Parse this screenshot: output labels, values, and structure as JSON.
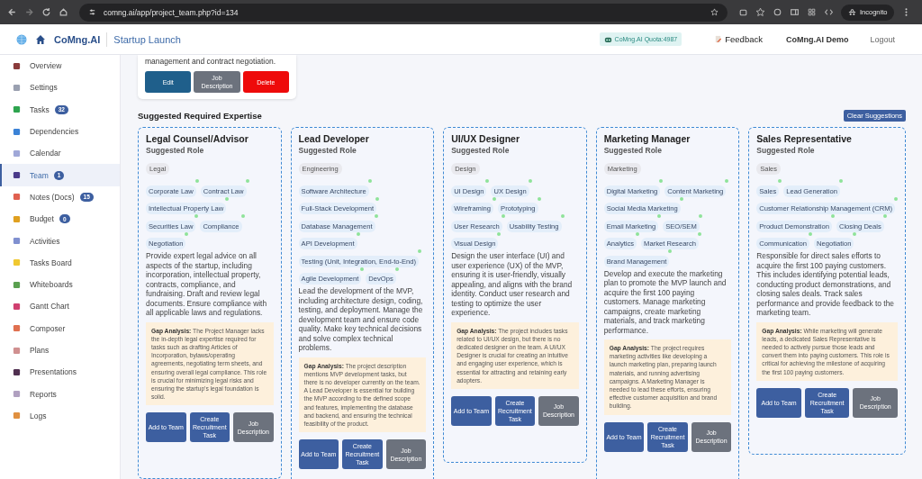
{
  "browser": {
    "url": "comng.ai/app/project_team.php?id=134",
    "profile": "Incognito"
  },
  "header": {
    "brand": "CoMng.AI",
    "project": "Startup Launch",
    "quota": "CoMng.AI Quota:4987",
    "feedback": "Feedback",
    "user": "CoMng.AI Demo",
    "logout": "Logout"
  },
  "sidebar": {
    "items": [
      {
        "label": "Overview",
        "selected": false
      },
      {
        "label": "Settings",
        "selected": false
      },
      {
        "label": "Tasks",
        "badge": "32",
        "selected": false
      },
      {
        "label": "Dependencies",
        "selected": false
      },
      {
        "label": "Calendar",
        "selected": false
      },
      {
        "label": "Team",
        "badge": "1",
        "selected": true
      },
      {
        "label": "Notes (Docs)",
        "badge": "15",
        "selected": false
      },
      {
        "label": "Budget",
        "badge": "0",
        "selected": false
      },
      {
        "label": "Activities",
        "selected": false
      },
      {
        "label": "Tasks Board",
        "selected": false
      },
      {
        "label": "Whiteboards",
        "selected": false
      },
      {
        "label": "Gantt Chart",
        "selected": false
      },
      {
        "label": "Composer",
        "selected": false
      },
      {
        "label": "Plans",
        "selected": false
      },
      {
        "label": "Presentations",
        "selected": false
      },
      {
        "label": "Reports",
        "selected": false
      },
      {
        "label": "Logs",
        "selected": false
      }
    ]
  },
  "member_card": {
    "description": "management and contract negotiation.",
    "buttons": [
      {
        "label": "Edit",
        "kind": "edit"
      },
      {
        "label": "Job Description",
        "kind": "secondary"
      },
      {
        "label": "Delete",
        "kind": "danger"
      }
    ]
  },
  "suggestions": {
    "title": "Suggested Required Expertise",
    "clear_button": "Clear Suggestions",
    "roles": [
      {
        "title": "Legal Counsel/Advisor",
        "subtitle": "Suggested Role",
        "category": "Legal",
        "skills": [
          "Corporate Law",
          "Contract Law",
          "Intellectual Property Law",
          "Securities Law",
          "Compliance",
          "Negotiation"
        ],
        "description": "Provide expert legal advice on all aspects of the startup, including incorporation, intellectual property, contracts, compliance, and fundraising. Draft and review legal documents. Ensure compliance with all applicable laws and regulations.",
        "gap": "**Gap Analysis:** The Project Manager lacks the in-depth legal expertise required for tasks such as drafting Articles of Incorporation, bylaws/operating agreements, negotiating term sheets, and ensuring overall legal compliance. This role is crucial for minimizing legal risks and ensuring the startup's legal foundation is solid.",
        "buttons": [
          {
            "label": "Add to Team",
            "kind": "primary"
          },
          {
            "label": "Create Recruitment Task",
            "kind": "primary"
          },
          {
            "label": "Job Description",
            "kind": "secondary"
          }
        ]
      },
      {
        "title": "Lead Developer",
        "subtitle": "Suggested Role",
        "category": "Engineering",
        "skills": [
          "Software Architecture",
          "Full-Stack Development",
          "Database Management",
          "API Development",
          "Testing (Unit, Integration, End-to-End)",
          "Agile Development",
          "DevOps"
        ],
        "description": "Lead the development of the MVP, including architecture design, coding, testing, and deployment. Manage the development team and ensure code quality. Make key technical decisions and solve complex technical problems.",
        "gap": "**Gap Analysis:** The project description mentions MVP development tasks, but there is no developer currently on the team. A Lead Developer is essential for building the MVP according to the defined scope and features, implementing the database and backend, and ensuring the technical feasibility of the product.",
        "buttons": [
          {
            "label": "Add to Team",
            "kind": "primary"
          },
          {
            "label": "Create Recruitment Task",
            "kind": "primary"
          },
          {
            "label": "Job Description",
            "kind": "secondary"
          }
        ]
      },
      {
        "title": "UI/UX Designer",
        "subtitle": "Suggested Role",
        "category": "Design",
        "skills": [
          "UI Design",
          "UX Design",
          "Wireframing",
          "Prototyping",
          "User Research",
          "Usability Testing",
          "Visual Design"
        ],
        "description": "Design the user interface (UI) and user experience (UX) of the MVP, ensuring it is user-friendly, visually appealing, and aligns with the brand identity. Conduct user research and testing to optimize the user experience.",
        "gap": "**Gap Analysis:** The project includes tasks related to UI/UX design, but there is no dedicated designer on the team. A UI/UX Designer is crucial for creating an intuitive and engaging user experience, which is essential for attracting and retaining early adopters.",
        "buttons": [
          {
            "label": "Add to Team",
            "kind": "primary"
          },
          {
            "label": "Create Recruitment Task",
            "kind": "primary"
          },
          {
            "label": "Job Description",
            "kind": "secondary"
          }
        ]
      },
      {
        "title": "Marketing Manager",
        "subtitle": "Suggested Role",
        "category": "Marketing",
        "skills": [
          "Digital Marketing",
          "Content Marketing",
          "Social Media Marketing",
          "Email Marketing",
          "SEO/SEM",
          "Analytics",
          "Market Research",
          "Brand Management"
        ],
        "description": "Develop and execute the marketing plan to promote the MVP launch and acquire the first 100 paying customers. Manage marketing campaigns, create marketing materials, and track marketing performance.",
        "gap": "**Gap Analysis:** The project requires marketing activities like developing a launch marketing plan, preparing launch materials, and running advertising campaigns. A Marketing Manager is needed to lead these efforts, ensuring effective customer acquisition and brand building.",
        "buttons": [
          {
            "label": "Add to Team",
            "kind": "primary"
          },
          {
            "label": "Create Recruitment Task",
            "kind": "primary"
          },
          {
            "label": "Job Description",
            "kind": "secondary"
          }
        ]
      },
      {
        "title": "Sales Representative",
        "subtitle": "Suggested Role",
        "category": "Sales",
        "skills": [
          "Sales",
          "Lead Generation",
          "Customer Relationship Management (CRM)",
          "Product Demonstration",
          "Closing Deals",
          "Communication",
          "Negotiation"
        ],
        "description": "Responsible for direct sales efforts to acquire the first 100 paying customers. This includes identifying potential leads, conducting product demonstrations, and closing sales deals. Track sales performance and provide feedback to the marketing team.",
        "gap": "**Gap Analysis:** While marketing will generate leads, a dedicated Sales Representative is needed to actively pursue those leads and convert them into paying customers. This role is critical for achieving the milestone of acquiring the first 100 paying customers.",
        "buttons": [
          {
            "label": "Add to Team",
            "kind": "primary"
          },
          {
            "label": "Create Recruitment Task",
            "kind": "primary"
          },
          {
            "label": "Job Description",
            "kind": "secondary"
          }
        ]
      }
    ]
  }
}
